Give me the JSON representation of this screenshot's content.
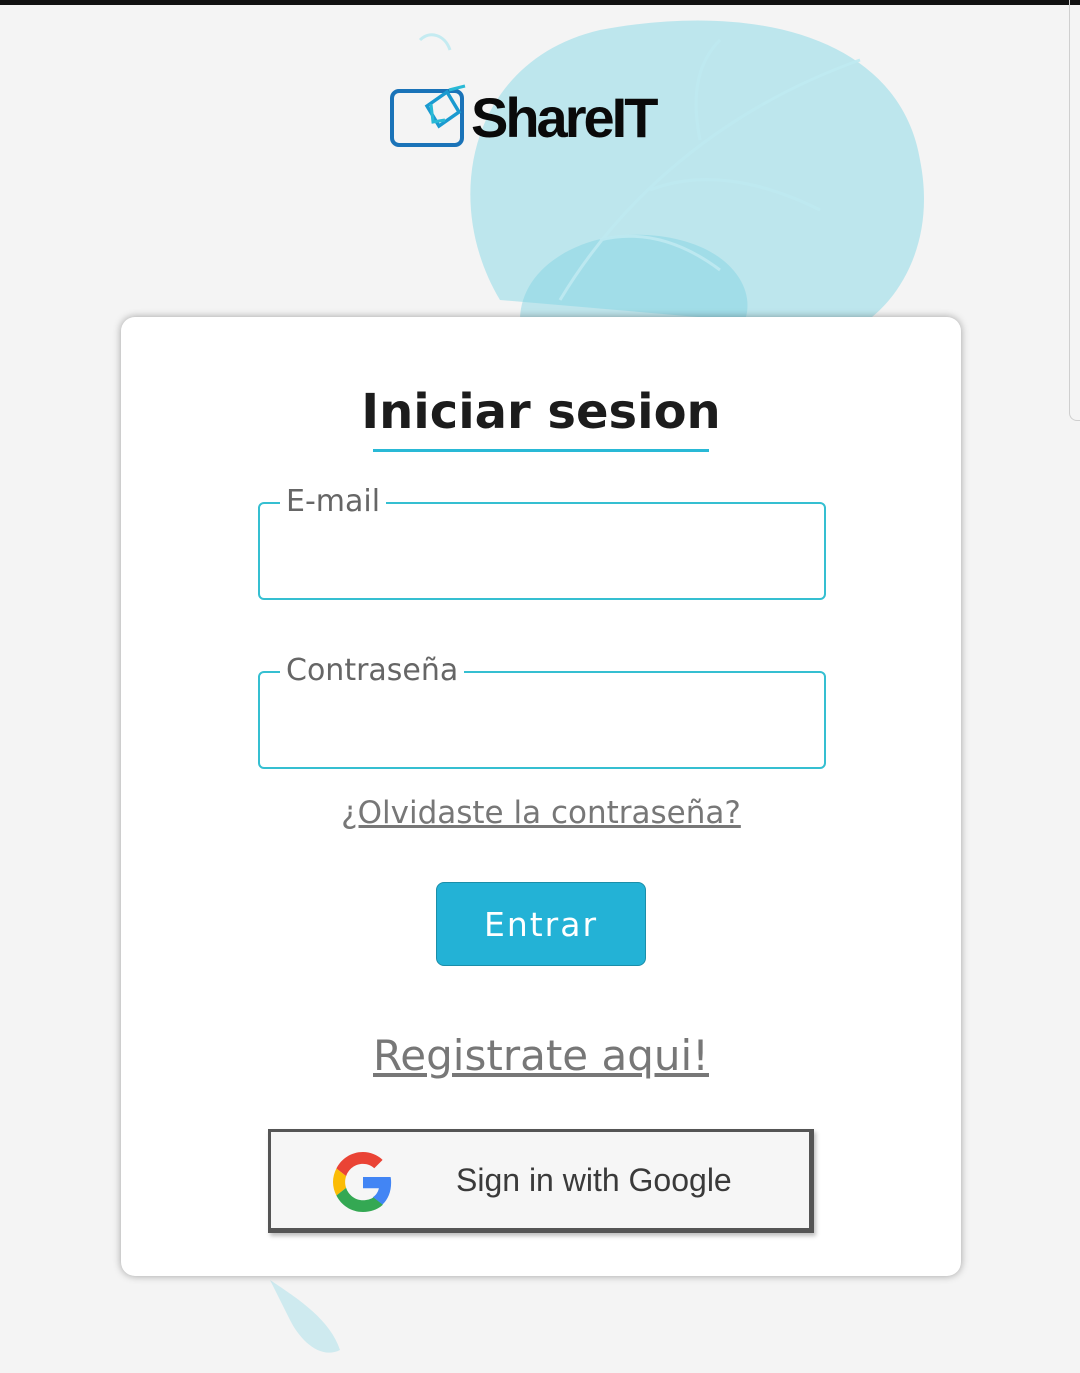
{
  "brand": {
    "name": "ShareIT",
    "accent": "#23b2d6"
  },
  "login": {
    "title": "Iniciar sesion",
    "email": {
      "label": "E-mail",
      "value": ""
    },
    "password": {
      "label": "Contraseña",
      "value": ""
    },
    "forgot_link": "¿Olvidaste la contraseña?",
    "submit_label": "Entrar",
    "register_link": "Registrate aqui!",
    "google_label": "Sign in with Google"
  },
  "icons": {
    "logo": "shareit-logo-icon",
    "google": "google-g-icon"
  }
}
